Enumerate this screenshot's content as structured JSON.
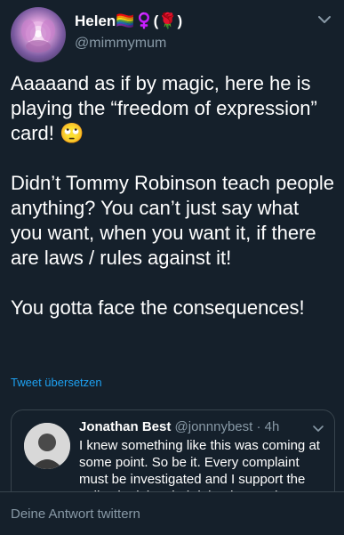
{
  "author": {
    "display_name": "Helen🏳️‍🌈♀️(🌹)",
    "handle": "@mimmymum"
  },
  "tweet": {
    "paragraphs": [
      "Aaaaand as if by magic, here he is playing the “freedom of expression” card! 🙄",
      "Didn’t Tommy Robinson teach people anything? You can’t just say what you want, when you want it, if there are laws / rules against it!",
      "You gotta face the consequences!"
    ],
    "translate_label": "Tweet übersetzen"
  },
  "quoted_tweet": {
    "name": "Jonathan Best",
    "handle": "@jonnnybest",
    "separator": " · ",
    "time": "4h",
    "text": "I knew something like this was coming at some point. So be it. Every complaint must be investigated and I support the police in doing their job. I knew what"
  },
  "reply_bar": {
    "placeholder": "Deine Antwort twittern"
  },
  "colors": {
    "background": "#15202b",
    "accent": "#1da1f2",
    "secondary_text": "#8899a6",
    "border": "#38444d"
  }
}
